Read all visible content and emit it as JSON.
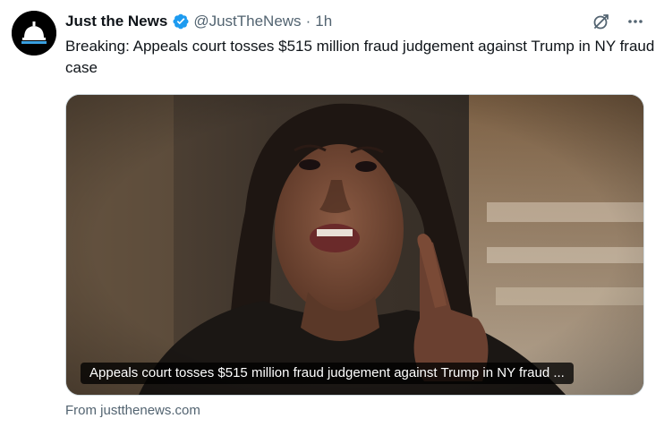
{
  "author": {
    "display_name": "Just the News",
    "handle": "@JustTheNews",
    "separator": "·",
    "time": "1h",
    "avatar_icon": "capitol-dome-logo",
    "verified_icon": "verified-badge-icon",
    "verified_color": "#1d9bf0"
  },
  "tweet": {
    "text": "Breaking: Appeals court tosses $515 million fraud judgement against Trump in NY fraud case"
  },
  "actions": {
    "grok_icon": "grok-icon",
    "more_icon": "more-icon"
  },
  "card": {
    "caption": "Appeals court tosses $515 million fraud judgement against Trump in NY fraud ...",
    "source": "From justthenews.com",
    "image_icon": "article-photo"
  },
  "colors": {
    "text_primary": "#0f1419",
    "text_secondary": "#536471",
    "border": "#cfd9de"
  }
}
